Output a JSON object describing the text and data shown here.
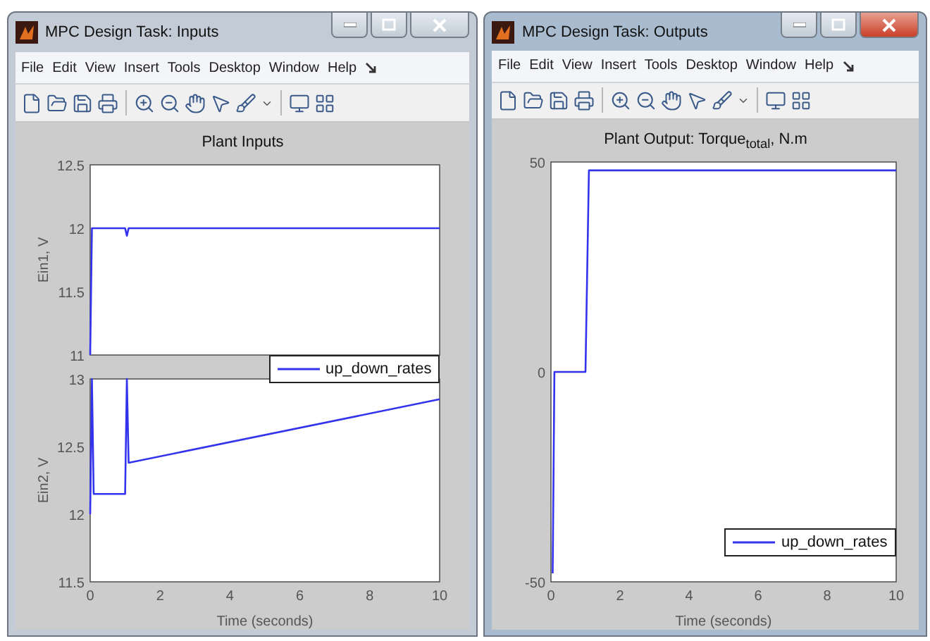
{
  "windows": [
    {
      "title": "MPC Design Task: Inputs",
      "active": false,
      "menu": [
        "File",
        "Edit",
        "View",
        "Insert",
        "Tools",
        "Desktop",
        "Window",
        "Help"
      ],
      "figure_title": "Plant Inputs",
      "charts": [
        {
          "chart_data": {
            "type": "line",
            "ylabel": "Ein1, V",
            "x": [
              0,
              0.05,
              0.1,
              1,
              1.05,
              1.1,
              10
            ],
            "series": [
              {
                "name": "up_down_rates",
                "color": "#3333ee",
                "values": [
                  11,
                  12,
                  12,
                  12,
                  11.94,
                  12,
                  12
                ]
              }
            ],
            "xlim": [
              0,
              10
            ],
            "ylim": [
              11,
              12.5
            ],
            "yticks": [
              {
                "value": 11,
                "label": "11"
              },
              {
                "value": 11.5,
                "label": "11.5"
              },
              {
                "value": 12,
                "label": "12"
              },
              {
                "value": 12.5,
                "label": "12.5"
              }
            ]
          }
        },
        {
          "chart_data": {
            "type": "line",
            "ylabel": "Ein2, V",
            "xlabel": "Time (seconds)",
            "x": [
              0,
              0.05,
              0.1,
              1,
              1.05,
              1.1,
              10
            ],
            "series": [
              {
                "color": "#3333ee",
                "values": [
                  12,
                  13,
                  12.15,
                  12.15,
                  13,
                  12.38,
                  12.85
                ]
              }
            ],
            "xlim": [
              0,
              10
            ],
            "ylim": [
              11.5,
              13
            ],
            "xticks": [
              {
                "value": 0,
                "label": "0"
              },
              {
                "value": 2,
                "label": "2"
              },
              {
                "value": 4,
                "label": "4"
              },
              {
                "value": 6,
                "label": "6"
              },
              {
                "value": 8,
                "label": "8"
              },
              {
                "value": 10,
                "label": "10"
              }
            ],
            "yticks": [
              {
                "value": 11.5,
                "label": "11.5"
              },
              {
                "value": 12,
                "label": "12"
              },
              {
                "value": 12.5,
                "label": "12.5"
              },
              {
                "value": 13,
                "label": "13"
              }
            ]
          }
        }
      ]
    },
    {
      "title": "MPC Design Task: Outputs",
      "active": true,
      "menu": [
        "File",
        "Edit",
        "View",
        "Insert",
        "Tools",
        "Desktop",
        "Window",
        "Help"
      ],
      "figure_title": "Plant Output: Torque$_{total}$, N.m",
      "charts": [
        {
          "chart_data": {
            "type": "line",
            "xlabel": "Time (seconds)",
            "x": [
              0.05,
              0.1,
              1,
              1.1,
              10
            ],
            "series": [
              {
                "name": "up_down_rates",
                "color": "#3333ee",
                "values": [
                  -48,
                  0,
                  0,
                  48,
                  48
                ]
              }
            ],
            "xlim": [
              0,
              10
            ],
            "ylim": [
              -50,
              50
            ],
            "xticks": [
              {
                "value": 0,
                "label": "0"
              },
              {
                "value": 2,
                "label": "2"
              },
              {
                "value": 4,
                "label": "4"
              },
              {
                "value": 6,
                "label": "6"
              },
              {
                "value": 8,
                "label": "8"
              },
              {
                "value": 10,
                "label": "10"
              }
            ],
            "yticks": [
              {
                "value": -50,
                "label": "-50"
              },
              {
                "value": 0,
                "label": "0"
              },
              {
                "value": 50,
                "label": "50"
              }
            ]
          }
        }
      ]
    }
  ]
}
